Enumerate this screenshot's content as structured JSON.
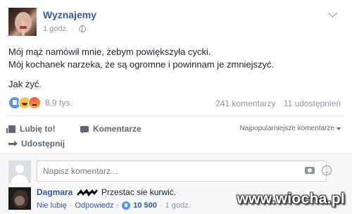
{
  "post": {
    "page_name": "Wyznajemy",
    "time": "1 godz.",
    "privacy_icon": "globe-icon",
    "text_lines": [
      "Mój mąż namówił mnie, żebym powiększyła cycki.",
      "Mój kochanek narzeka, że są ogromne i powinnam je zmniejszyć."
    ],
    "text_end": "Jak żyć.",
    "reaction_icons": [
      "like-reaction-icon",
      "haha-reaction-icon",
      "angry-reaction-icon"
    ],
    "reaction_count": "8,9 tys.",
    "comments_count": "241 komentarzy",
    "shares_count": "11 udostępnień"
  },
  "actions": {
    "like": "Lubię to!",
    "comment": "Komentarze",
    "share": "Udostępnij",
    "sort": "Najpopularniejsze komentarze"
  },
  "comment_box": {
    "placeholder": "Napisz komentarz..."
  },
  "top_comment": {
    "author": "Dagmara",
    "text": "Przestac sie kurwić.",
    "unlike": "Nie lubię",
    "reply": "Odpowiedz",
    "likes": "10 500",
    "time": "1 godz.",
    "separator": "·"
  },
  "watermark": "www.wiocha.pl",
  "colors": {
    "link": "#365899",
    "meta": "#90949c",
    "like_blue": "#5890ff",
    "comments_bg": "#f6f7f9"
  }
}
